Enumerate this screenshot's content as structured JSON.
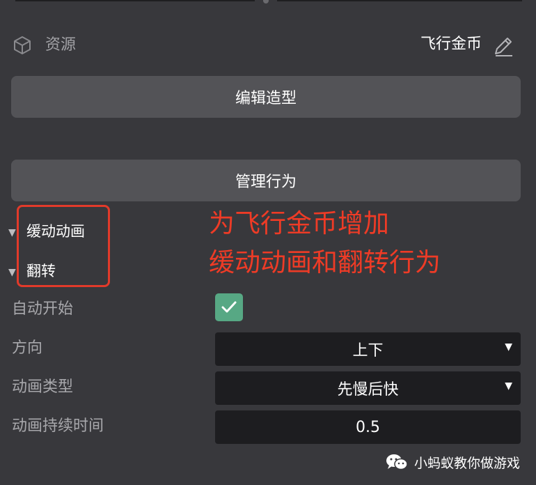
{
  "resource": {
    "label": "资源",
    "asset_name": "飞行金币"
  },
  "buttons": {
    "edit_shape": "编辑造型",
    "manage_behavior": "管理行为"
  },
  "behaviors": [
    {
      "label": "缓动动画"
    },
    {
      "label": "翻转"
    }
  ],
  "annotation": {
    "line1": "为飞行金币增加",
    "line2": "缓动动画和翻转行为"
  },
  "properties": {
    "auto_start": {
      "label": "自动开始",
      "checked": true
    },
    "direction": {
      "label": "方向",
      "value": "上下"
    },
    "anim_type": {
      "label": "动画类型",
      "value": "先慢后快"
    },
    "duration": {
      "label": "动画持续时间",
      "value": "0.5"
    }
  },
  "watermark": {
    "text": "小蚂蚁教你做游戏",
    "icon": "wechat-icon"
  },
  "colors": {
    "annotation_red": "#ee3b26",
    "checkbox_green": "#57a884",
    "panel_bg": "#38383c"
  }
}
